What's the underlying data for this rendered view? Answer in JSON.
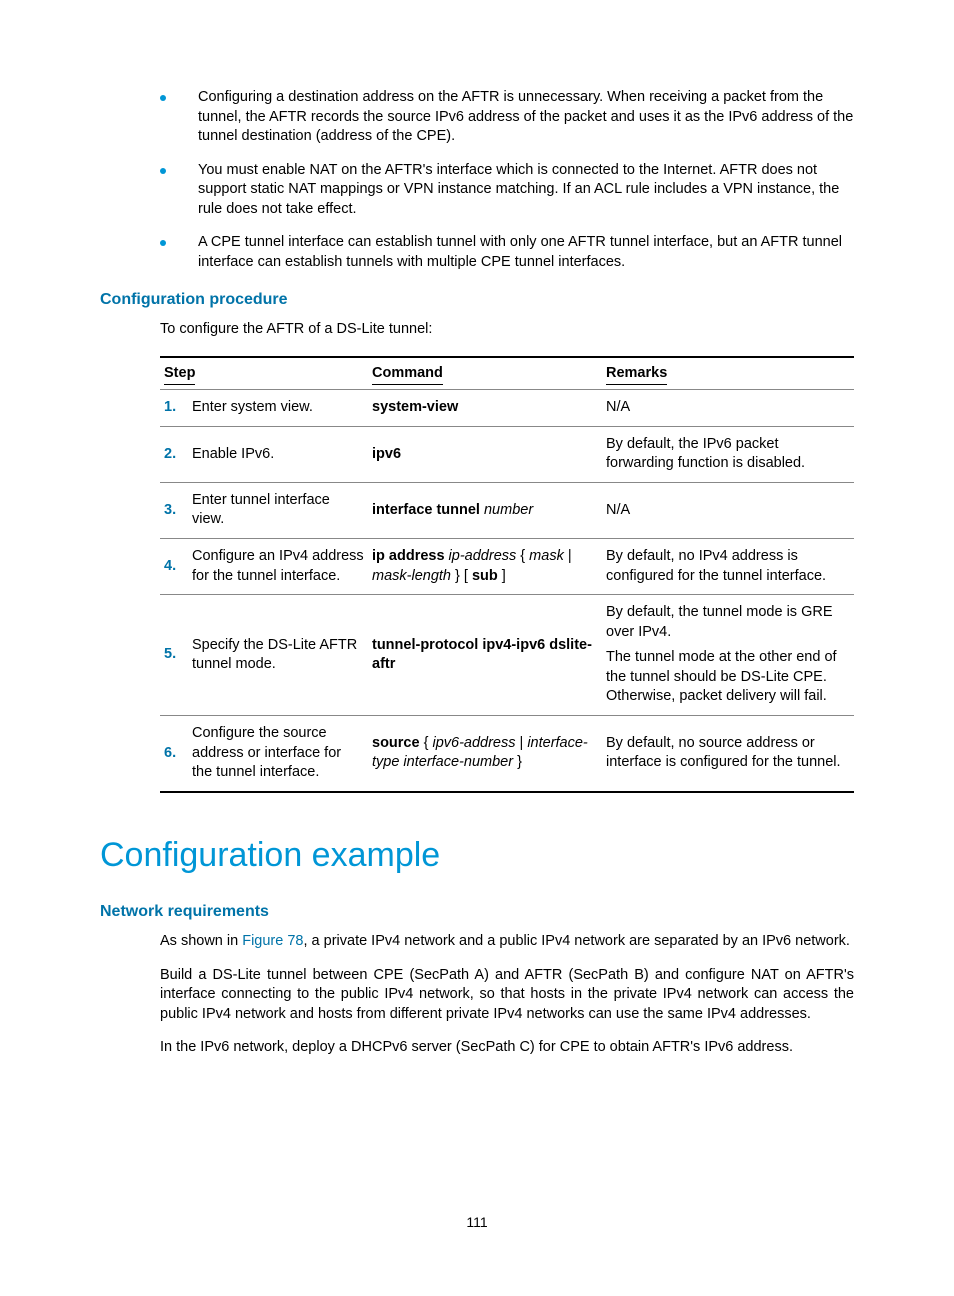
{
  "bullets": {
    "b1": "Configuring a destination address on the AFTR is unnecessary. When receiving a packet from the tunnel, the AFTR records the source IPv6 address of the packet and uses it as the IPv6 address of the tunnel destination (address of the CPE).",
    "b2": "You must enable NAT on the AFTR's interface which is connected to the Internet. AFTR does not support static NAT mappings or VPN instance matching. If an ACL rule includes a VPN instance, the rule does not take effect.",
    "b3": "A CPE tunnel interface can establish tunnel with only one AFTR tunnel interface, but an AFTR tunnel interface can establish tunnels with multiple CPE tunnel interfaces."
  },
  "headings": {
    "config_procedure": "Configuration procedure",
    "config_example": "Configuration example",
    "net_req": "Network requirements"
  },
  "intro": "To configure the AFTR of a DS-Lite tunnel:",
  "table": {
    "h_step": "Step",
    "h_cmd": "Command",
    "h_rem": "Remarks",
    "rows": {
      "r1": {
        "num": "1.",
        "step": "Enter system view.",
        "cmd_b": "system-view",
        "rem": "N/A"
      },
      "r2": {
        "num": "2.",
        "step": "Enable IPv6.",
        "cmd_b": "ipv6",
        "rem": "By default, the IPv6 packet forwarding function is disabled."
      },
      "r3": {
        "num": "3.",
        "step": "Enter tunnel interface view.",
        "cmd_b": "interface tunnel",
        "cmd_i": " number",
        "rem": "N/A"
      },
      "r4": {
        "num": "4.",
        "step": "Configure an IPv4 address for the tunnel interface.",
        "cmd_b": "ip address",
        "cmd_i1": " ip-address",
        "cmd_t1": " { ",
        "cmd_i2": "mask",
        "cmd_t2": " | ",
        "cmd_i3": "mask-length",
        "cmd_t3": " } [ ",
        "cmd_b2": "sub",
        "cmd_t4": " ]",
        "rem": "By default, no IPv4 address is configured for the tunnel interface."
      },
      "r5": {
        "num": "5.",
        "step": "Specify the DS-Lite AFTR tunnel mode.",
        "cmd_b": "tunnel-protocol ipv4-ipv6 dslite-aftr",
        "rem1": "By default, the tunnel mode is GRE over IPv4.",
        "rem2": "The tunnel mode at the other end of the tunnel should be DS-Lite CPE. Otherwise, packet delivery will fail."
      },
      "r6": {
        "num": "6.",
        "step": "Configure the source address or interface for the tunnel interface.",
        "cmd_b": "source",
        "cmd_t1": " { ",
        "cmd_i1": "ipv6-address",
        "cmd_t2": " | ",
        "cmd_i2": "interface-type interface-number",
        "cmd_t3": " }",
        "rem": "By default, no source address or interface is configured for the tunnel."
      }
    }
  },
  "netreq": {
    "p1_pre": "As shown in ",
    "p1_link": "Figure 78",
    "p1_post": ", a private IPv4 network and a public IPv4 network are separated by an IPv6 network.",
    "p2": "Build a DS-Lite tunnel between CPE (SecPath A) and AFTR (SecPath B) and configure NAT on AFTR's interface connecting to the public IPv4 network, so that hosts in the private IPv4 network can access the public IPv4 network and hosts from different private IPv4 networks can use the same IPv4 addresses.",
    "p3": "In the IPv6 network, deploy a DHCPv6 server (SecPath C) for CPE to obtain AFTR's IPv6 address."
  },
  "pagenum": "111"
}
